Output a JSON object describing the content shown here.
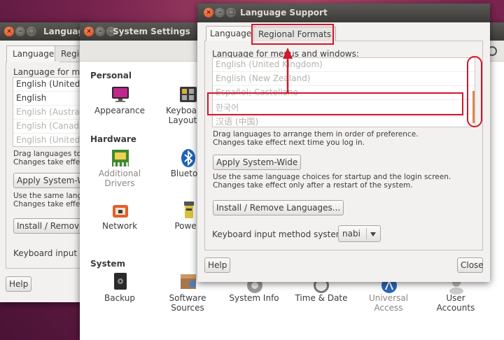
{
  "back_window": {
    "title": "Language",
    "tabs": [
      "Language",
      "Regio"
    ],
    "heading": "Language for men",
    "languages": [
      "English (United S",
      "English",
      "English (Australi",
      "English (Canada)",
      "English (United K"
    ],
    "drag_note_1": "Drag languages to",
    "drag_note_2": "Changes take effect",
    "apply_label": "Apply System-Wi",
    "same_note_1": "Use the same languag",
    "same_note_2": "Changes take effect",
    "install_label": "Install / Remove",
    "keyboard_label": "Keyboard input m",
    "help_label": "Help"
  },
  "system_settings": {
    "title": "System Settings",
    "sections": {
      "personal": "Personal",
      "hardware": "Hardware",
      "system": "System"
    },
    "items": {
      "appearance": "Appearance",
      "keyboard_1": "Keyboa",
      "keyboard_2": "Layout",
      "additional_1": "Additional",
      "additional_2": "Drivers",
      "bluetooth": "Blueto",
      "network": "Network",
      "power": "Powe",
      "backup": "Backup",
      "software_1": "Software",
      "software_2": "Sources",
      "system_info": "System Info",
      "time_date": "Time & Date",
      "universal_1": "Universal",
      "universal_2": "Access",
      "user_1": "User",
      "user_2": "Accounts"
    }
  },
  "language_support": {
    "title": "Language Support",
    "tabs": {
      "language": "Language",
      "regional": "Regional Formats"
    },
    "heading": "Language for menus and windows:",
    "languages": [
      "English (United Kingdom)",
      "English (New Zealand)",
      "Español; Castellano",
      "한국어",
      "汉语 (中国)"
    ],
    "drag_note_1": "Drag languages to arrange them in order of preference.",
    "drag_note_2": "Changes take effect next time you log in.",
    "apply_label": "Apply System-Wide",
    "same_note_1": "Use the same language choices for startup and the login screen.",
    "same_note_2": "Changes take effect only after a restart of the system.",
    "install_label": "Install / Remove Languages...",
    "keyboard_label": "Keyboard input method system:",
    "keyboard_value": "nabi",
    "help_label": "Help",
    "close_label": "Close"
  },
  "colors": {
    "annotation": "#d4162a",
    "titlebar": "#3c3b37",
    "close_button": "#d9451a"
  }
}
